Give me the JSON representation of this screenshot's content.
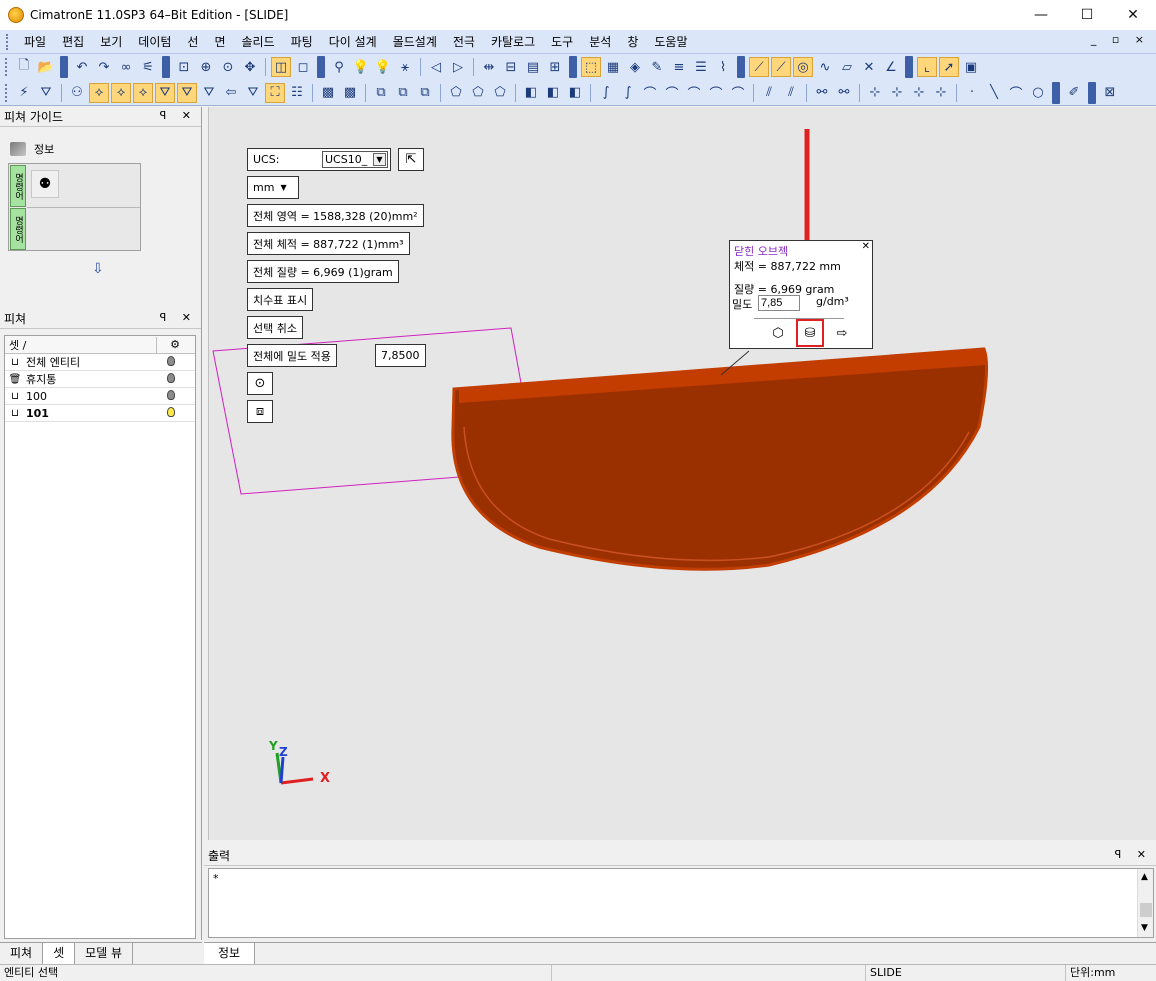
{
  "window": {
    "title": "CimatronE 11.0SP3 64–Bit Edition - [SLIDE]",
    "controls": [
      "—",
      "☐",
      "✕"
    ]
  },
  "menu": {
    "items": [
      "파일",
      "편집",
      "보기",
      "데이텀",
      "선",
      "면",
      "솔리드",
      "파팅",
      "다이 설계",
      "몰드설계",
      "전극",
      "카탈로그",
      "도구",
      "분석",
      "창",
      "도움말"
    ],
    "mdi_controls": "_ ▫ ×"
  },
  "feature_guide": {
    "title": "피쳐 가이드",
    "info_label": "정보",
    "tab1": "명령어",
    "tab2": "명령어"
  },
  "features_panel": {
    "title": "피쳐",
    "col_header": "셋 /",
    "rows": [
      {
        "name": "전체 엔티티",
        "bold": false,
        "bulb_on": false
      },
      {
        "name": "휴지통",
        "bold": false,
        "bulb_on": false
      },
      {
        "name": "100",
        "bold": false,
        "bulb_on": false
      },
      {
        "name": "101",
        "bold": true,
        "bulb_on": true
      }
    ]
  },
  "left_tabs": [
    "피쳐",
    "셋",
    "모델 뷰"
  ],
  "viewport": {
    "ucs_label": "UCS:",
    "ucs_value": "UCS10_",
    "unit": "mm",
    "area": "전체 영역 = 1588,328 (20)mm²",
    "volume": "전체 체적 = 887,722 (1)mm³",
    "mass": "전체 질량 = 6,969 (1)gram",
    "show_dim": "치수표 표시",
    "cancel_sel": "선택 취소",
    "apply_density": "전체에 밀도 적용",
    "density_value": "7,8500",
    "axis_x": "X",
    "axis_y": "Y",
    "axis_z": "Z"
  },
  "popup": {
    "title": "닫힌 오브젝",
    "volume": "체적 = 887,722 mm",
    "mass": "질량 = 6,969 gram",
    "density_label": "밀도",
    "density_value": "7,85",
    "density_unit": "g/dm³"
  },
  "output": {
    "title": "출력",
    "content": "*"
  },
  "right_tabs": [
    "정보"
  ],
  "status": {
    "left": "엔티티 선택",
    "mode": "SLIDE",
    "unit": "단위:mm"
  },
  "colors": {
    "part": "#9a3000",
    "arrow": "#e02020",
    "sketch": "#d020c0"
  }
}
